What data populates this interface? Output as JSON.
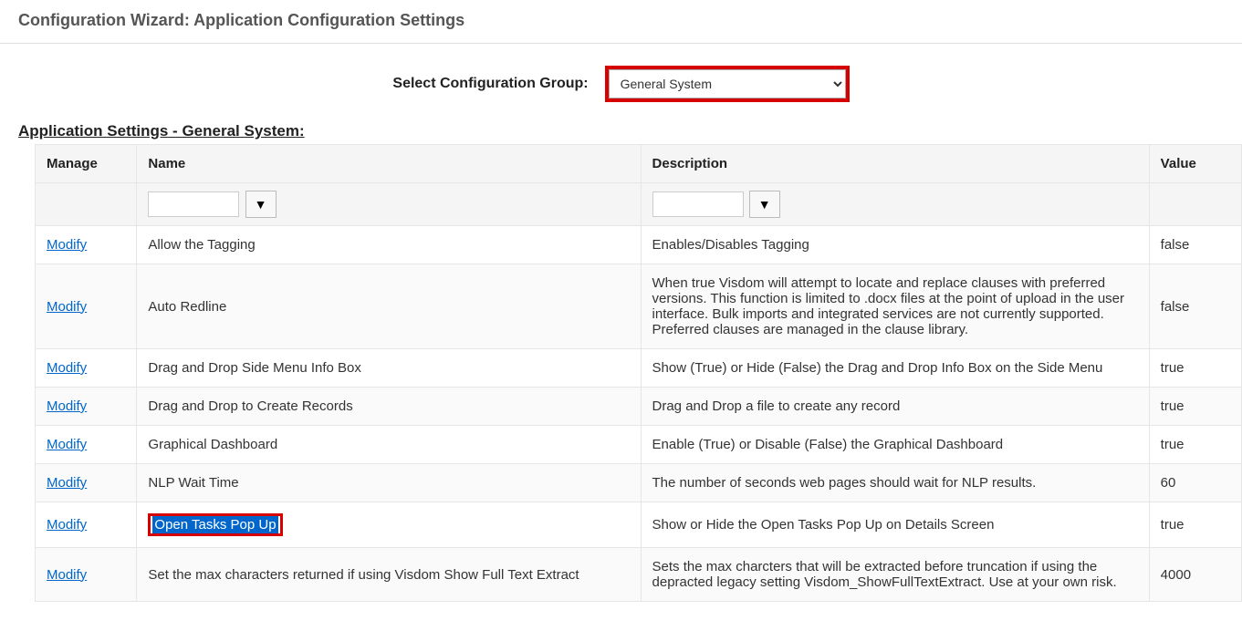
{
  "header": {
    "title": "Configuration Wizard: Application Configuration Settings"
  },
  "selector": {
    "label": "Select Configuration Group:",
    "value": "General System"
  },
  "section": {
    "title": "Application Settings - General System:"
  },
  "table": {
    "headers": {
      "manage": "Manage",
      "name": "Name",
      "description": "Description",
      "value": "Value"
    },
    "modify_label": "Modify",
    "rows": [
      {
        "name": "Allow the Tagging",
        "description": "Enables/Disables Tagging",
        "value": "false"
      },
      {
        "name": "Auto Redline",
        "description": "When true Visdom will attempt to locate and replace clauses with preferred versions. This function is limited to .docx files at the point of upload in the user interface. Bulk imports and integrated services are not currently supported. Preferred clauses are managed in the clause library.",
        "value": "false"
      },
      {
        "name": "Drag and Drop Side Menu Info Box",
        "description": "Show (True) or Hide (False) the Drag and Drop Info Box on the Side Menu",
        "value": "true"
      },
      {
        "name": "Drag and Drop to Create Records",
        "description": "Drag and Drop a file to create any record",
        "value": "true"
      },
      {
        "name": "Graphical Dashboard",
        "description": "Enable (True) or Disable (False) the Graphical Dashboard",
        "value": "true"
      },
      {
        "name": "NLP Wait Time",
        "description": "The number of seconds web pages should wait for NLP results.",
        "value": "60"
      },
      {
        "name": "Open Tasks Pop Up",
        "description": "Show or Hide the Open Tasks Pop Up on Details Screen",
        "value": "true",
        "highlighted": true
      },
      {
        "name": "Set the max characters returned if using Visdom Show Full Text Extract",
        "description": "Sets the max charcters that will be extracted before truncation if using the depracted legacy setting Visdom_ShowFullTextExtract. Use at your own risk.",
        "value": "4000"
      }
    ]
  }
}
